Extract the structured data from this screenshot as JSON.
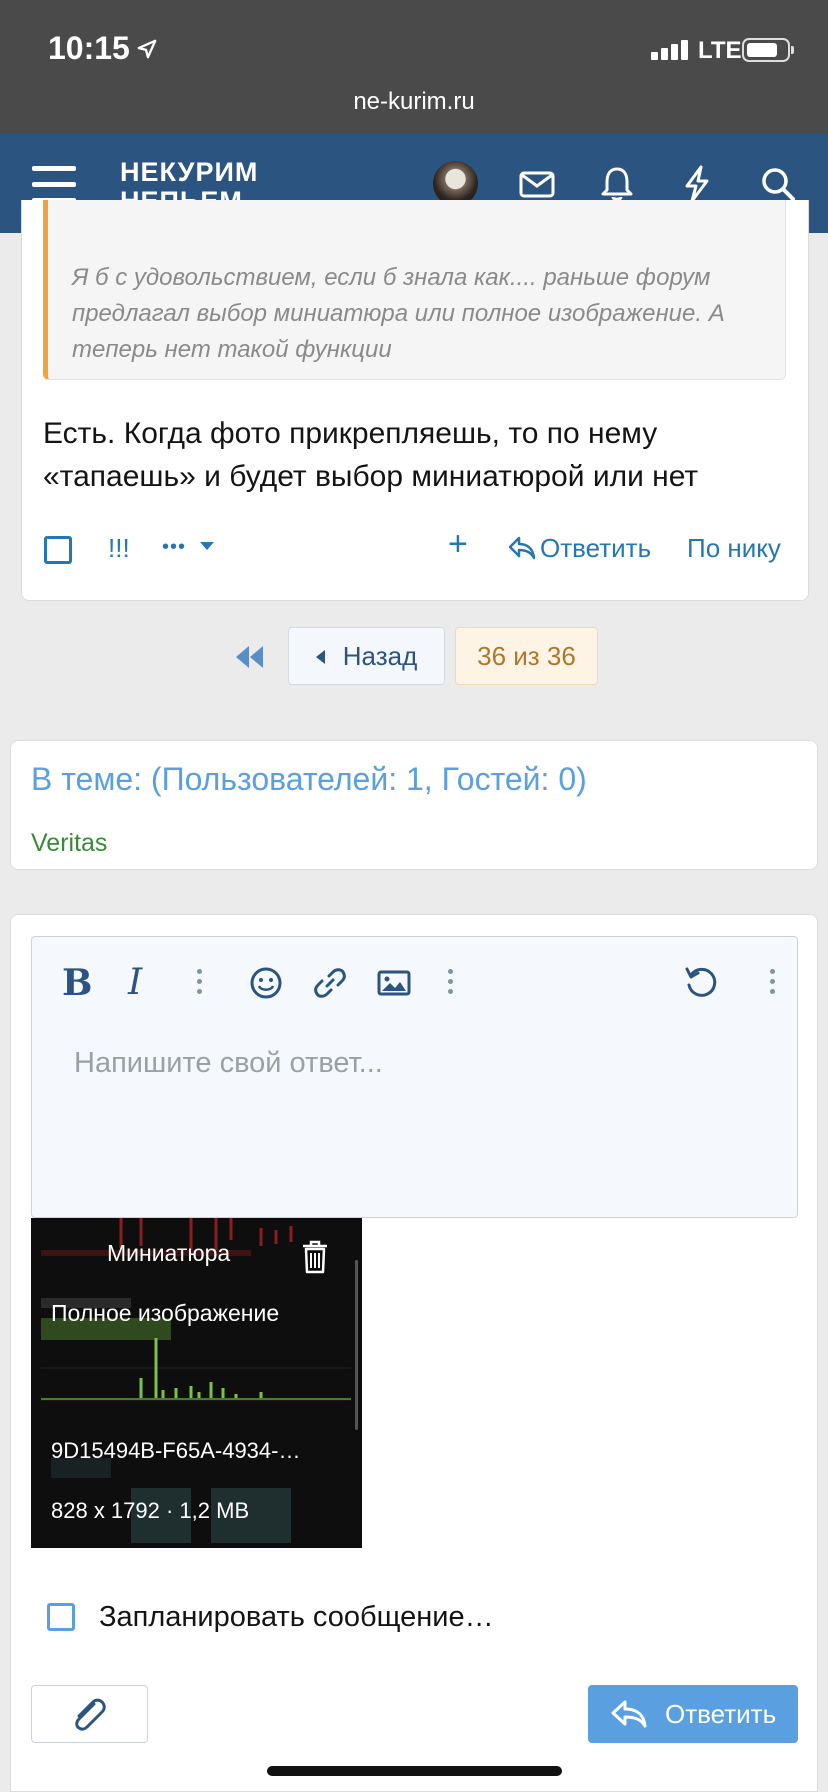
{
  "status_bar": {
    "time": "10:15",
    "network": "LTE",
    "url": "ne-kurim.ru",
    "icons": [
      "location-arrow-icon",
      "signal-bars-icon",
      "battery-icon"
    ]
  },
  "header": {
    "logo_line1": "НЕКУРИМ",
    "logo_line2": "НЕПЬЕМ…",
    "icons": [
      "menu-icon",
      "avatar",
      "envelope-icon",
      "bell-icon",
      "lightning-icon",
      "search-icon"
    ]
  },
  "post": {
    "quote_text": "Я б с удовольствием, если б знала как.... раньше форум предлагал выбор миниатюра или полное изображение. А теперь нет такой функции",
    "body": "Есть. Когда фото прикрепляешь, то по нему «тапаешь» и будет выбор миниатюрой или нет",
    "actions": {
      "exclaim": "!!!",
      "more": "•••",
      "plus": "+",
      "reply": "Ответить",
      "by_nick": "По нику"
    }
  },
  "pagination": {
    "prev": "Назад",
    "current": "36 из 36"
  },
  "online": {
    "title": "В теме: (Пользователей: 1, Гостей: 0)",
    "user": "Veritas"
  },
  "editor": {
    "bold": "B",
    "italic": "I",
    "placeholder": "Напишите свой ответ...",
    "toolbar_icons": [
      "bold-icon",
      "italic-icon",
      "more-icon",
      "emoji-icon",
      "link-icon",
      "image-icon",
      "more-icon",
      "undo-icon",
      "more-icon"
    ]
  },
  "attachment": {
    "mini": "Миниатюра",
    "full": "Полное изображение",
    "filename": "9D15494B-F65A-4934-…",
    "meta": "828 x 1792 · 1,2 MB"
  },
  "schedule_label": "Запланировать сообщение…",
  "reply_button": "Ответить",
  "colors": {
    "header_bg": "#2b5480",
    "link": "#2577b1",
    "quote_accent": "#f0a33a",
    "online_title": "#5aa0e0",
    "online_user": "#3b8a3b",
    "reply_btn": "#5aa0e0"
  }
}
